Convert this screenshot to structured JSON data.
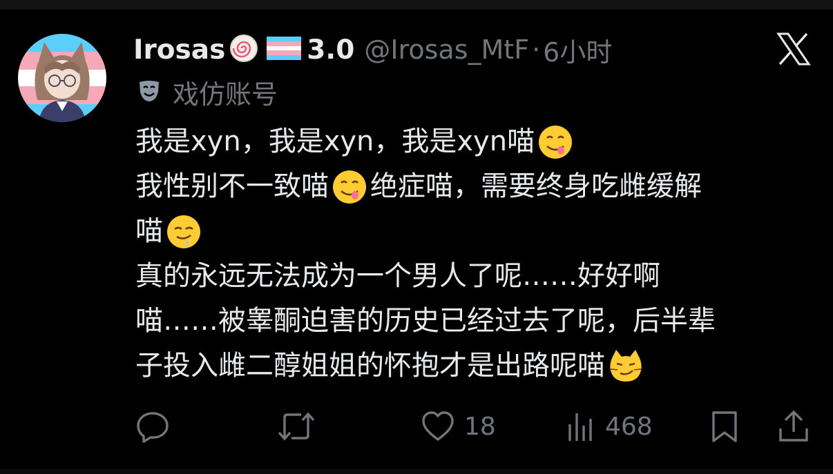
{
  "user": {
    "display_name": "Irosas",
    "version": "3.0",
    "handle": "@Irosas_MtF",
    "separator": "·",
    "timestamp": "6小时",
    "account_label": "戏仿账号",
    "badge_icon": "narutomaki-icon",
    "flag_icon": "transgender-flag-icon",
    "label_icon": "theater-mask-icon"
  },
  "post": {
    "line1": "我是xyn，我是xyn，我是xyn喵",
    "line2a": "我性别不一致喵",
    "line2b": "绝症喵，需要终身吃雌缓解",
    "line3": "喵",
    "line4": "真的永远无法成为一个男人了呢……好好啊",
    "line5": "喵……被睾酮迫害的历史已经过去了呢，后半辈",
    "line6": "子投入雌二醇姐姐的怀抱才是出路呢喵"
  },
  "actions": {
    "reply_count": "",
    "repost_count": "",
    "like_count": "18",
    "view_count": "468"
  },
  "colors": {
    "background": "#000000",
    "text_primary": "#e7e9ea",
    "text_secondary": "#71767b",
    "trans_blue": "#5bcefa",
    "trans_pink": "#f5a9b8"
  }
}
